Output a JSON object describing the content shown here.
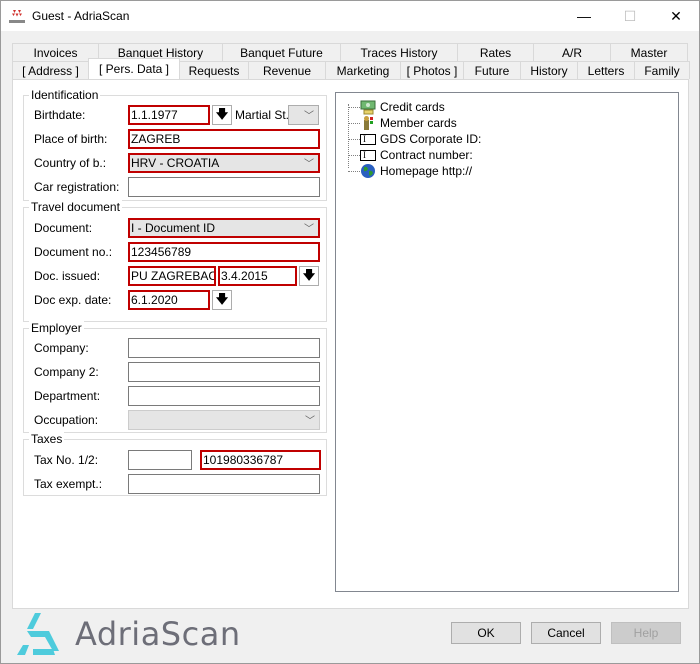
{
  "window": {
    "title": "Guest - AdriaScan",
    "app_icon": "protel-logo-icon",
    "controls": {
      "minimize": "—",
      "maximize": "☐",
      "close": "✕"
    }
  },
  "tabs": {
    "row1": [
      "Invoices",
      "Banquet History",
      "Banquet Future",
      "Traces History",
      "Rates",
      "A/R",
      "Master"
    ],
    "row2": [
      "[ Address ]",
      "[ Pers. Data ]",
      "Requests",
      "Revenue",
      "Marketing",
      "[ Photos ]",
      "Future",
      "History",
      "Letters",
      "Family"
    ],
    "active": "[ Pers. Data ]"
  },
  "identification": {
    "title": "Identification",
    "birthdate_label": "Birthdate:",
    "birthdate_value": "1.1.1977",
    "marital_label": "Martial St.",
    "marital_value": "",
    "place_label": "Place of birth:",
    "place_value": "ZAGREB",
    "country_label": "Country of b.:",
    "country_value": "HRV - CROATIA",
    "car_label": "Car registration:",
    "car_value": ""
  },
  "travel": {
    "title": "Travel document",
    "document_label": "Document:",
    "document_value": "I - Document ID",
    "docno_label": "Document no.:",
    "docno_value": "123456789",
    "issued_label": "Doc. issued:",
    "issued_place": "PU ZAGREBACK",
    "issued_date": "3.4.2015",
    "exp_label": "Doc exp. date:",
    "exp_value": "6.1.2020"
  },
  "employer": {
    "title": "Employer",
    "company_label": "Company:",
    "company_value": "",
    "company2_label": "Company 2:",
    "company2_value": "",
    "department_label": "Department:",
    "department_value": "",
    "occupation_label": "Occupation:",
    "occupation_value": ""
  },
  "taxes": {
    "title": "Taxes",
    "taxno_label": "Tax No. 1/2:",
    "tax1_value": "",
    "tax2_value": "101980336787",
    "exempt_label": "Tax exempt.:",
    "exempt_value": ""
  },
  "tree": {
    "items": [
      {
        "label": "Credit cards",
        "icon": "credit-card-icon"
      },
      {
        "label": "Member cards",
        "icon": "member-card-icon"
      },
      {
        "label": "GDS Corporate ID:",
        "icon": "text-field-icon"
      },
      {
        "label": "Contract number:",
        "icon": "text-field-icon"
      },
      {
        "label": "Homepage http://",
        "icon": "globe-icon"
      }
    ]
  },
  "logo": {
    "text": "AdriaScan"
  },
  "buttons": {
    "ok": "OK",
    "cancel": "Cancel",
    "help": "Help"
  },
  "colors": {
    "required_border": "#c00000",
    "logo_accent": "#4ecbdc",
    "logo_text": "#6d6e78"
  }
}
